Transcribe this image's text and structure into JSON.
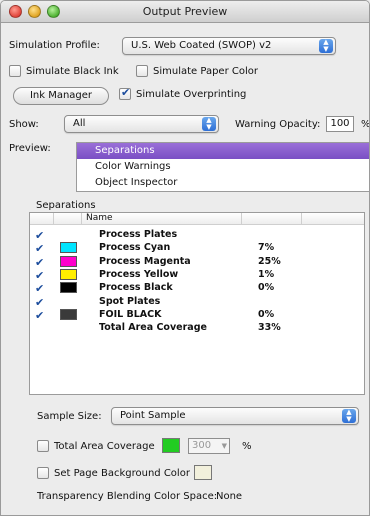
{
  "window": {
    "title": "Output Preview"
  },
  "simulation_profile": {
    "label": "Simulation Profile:",
    "value": "U.S. Web Coated (SWOP) v2"
  },
  "simulate_black_ink": {
    "label": "Simulate Black Ink",
    "checked": false
  },
  "simulate_paper_color": {
    "label": "Simulate Paper Color",
    "checked": false
  },
  "ink_manager": {
    "label": "Ink Manager"
  },
  "simulate_overprinting": {
    "label": "Simulate Overprinting",
    "checked": true
  },
  "show": {
    "label": "Show:",
    "value": "All"
  },
  "warning_opacity": {
    "label": "Warning Opacity:",
    "value": "100",
    "unit": "%"
  },
  "preview": {
    "label": "Preview:",
    "items": [
      {
        "label": "Separations",
        "selected": true
      },
      {
        "label": "Color Warnings",
        "selected": false
      },
      {
        "label": "Object Inspector",
        "selected": false
      }
    ]
  },
  "separations": {
    "label": "Separations",
    "column_name": "Name",
    "rows": [
      {
        "checked": true,
        "swatch": null,
        "name": "Process Plates",
        "pct": ""
      },
      {
        "checked": true,
        "swatch": "#00e5ff",
        "name": "Process Cyan",
        "pct": "7%"
      },
      {
        "checked": true,
        "swatch": "#ff00cc",
        "name": "Process Magenta",
        "pct": "25%"
      },
      {
        "checked": true,
        "swatch": "#ffee00",
        "name": "Process Yellow",
        "pct": "1%"
      },
      {
        "checked": true,
        "swatch": "#000000",
        "name": "Process Black",
        "pct": "0%"
      },
      {
        "checked": true,
        "swatch": null,
        "name": "Spot Plates",
        "pct": ""
      },
      {
        "checked": true,
        "swatch": "#3a3a3a",
        "name": "FOIL BLACK",
        "pct": "0%"
      },
      {
        "checked": false,
        "swatch": null,
        "name": "Total Area Coverage",
        "pct": "33%"
      }
    ]
  },
  "sample_size": {
    "label": "Sample Size:",
    "value": "Point Sample"
  },
  "total_area_coverage": {
    "label": "Total Area Coverage",
    "checked": false,
    "swatch_color": "#22cc22",
    "value": "300",
    "unit": "%"
  },
  "page_background": {
    "label": "Set Page Background Color",
    "checked": false,
    "swatch_color": "#f2f0dc"
  },
  "transparency": {
    "label": "Transparency Blending Color Space:",
    "value": "None"
  }
}
